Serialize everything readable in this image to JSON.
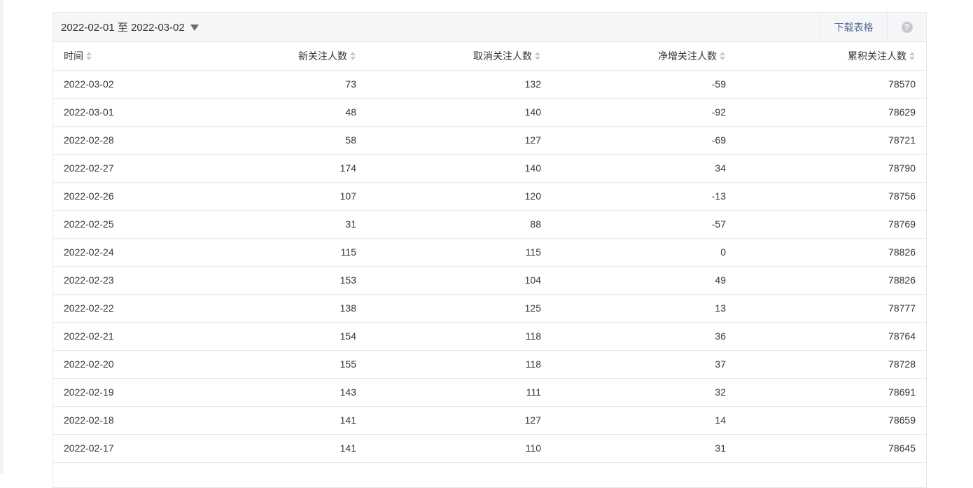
{
  "toolbar": {
    "date_range": "2022-02-01 至 2022-03-02",
    "download_label": "下载表格",
    "help_label": "?"
  },
  "table": {
    "headers": [
      "时间",
      "新关注人数",
      "取消关注人数",
      "净增关注人数",
      "累积关注人数"
    ],
    "rows": [
      [
        "2022-03-02",
        "73",
        "132",
        "-59",
        "78570"
      ],
      [
        "2022-03-01",
        "48",
        "140",
        "-92",
        "78629"
      ],
      [
        "2022-02-28",
        "58",
        "127",
        "-69",
        "78721"
      ],
      [
        "2022-02-27",
        "174",
        "140",
        "34",
        "78790"
      ],
      [
        "2022-02-26",
        "107",
        "120",
        "-13",
        "78756"
      ],
      [
        "2022-02-25",
        "31",
        "88",
        "-57",
        "78769"
      ],
      [
        "2022-02-24",
        "115",
        "115",
        "0",
        "78826"
      ],
      [
        "2022-02-23",
        "153",
        "104",
        "49",
        "78826"
      ],
      [
        "2022-02-22",
        "138",
        "125",
        "13",
        "78777"
      ],
      [
        "2022-02-21",
        "154",
        "118",
        "36",
        "78764"
      ],
      [
        "2022-02-20",
        "155",
        "118",
        "37",
        "78728"
      ],
      [
        "2022-02-19",
        "143",
        "111",
        "32",
        "78691"
      ],
      [
        "2022-02-18",
        "141",
        "127",
        "14",
        "78659"
      ],
      [
        "2022-02-17",
        "141",
        "110",
        "31",
        "78645"
      ]
    ]
  },
  "colors": {
    "link": "#576b95",
    "header_bg": "#f5f6f8",
    "border": "#e6e7eb"
  }
}
